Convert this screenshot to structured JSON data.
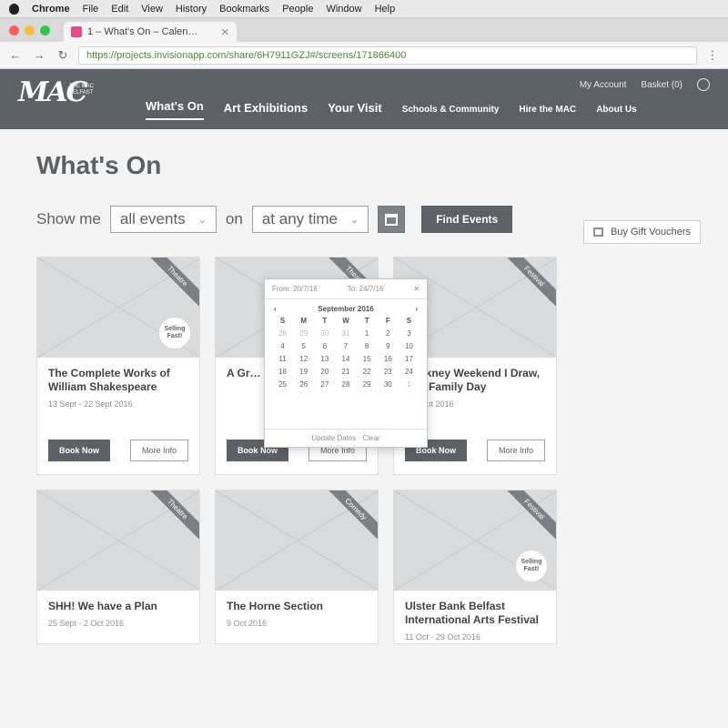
{
  "menubar": {
    "items": [
      "Chrome",
      "File",
      "Edit",
      "View",
      "History",
      "Bookmarks",
      "People",
      "Window",
      "Help"
    ]
  },
  "browser": {
    "tab_title": "1 – What's On – Calen…",
    "url": "https://projects.invisionapp.com/share/6H7911GZJ#/screens/171866400",
    "traffic_light_colors": [
      "#fc605b",
      "#fdbc40",
      "#34c84a"
    ]
  },
  "site": {
    "logo_mark": "MAC",
    "logo_sub": "THE MAC BELFAST",
    "util": {
      "account": "My Account",
      "basket": "Basket (0)"
    },
    "nav": [
      {
        "label": "What's On",
        "active": true,
        "size": "large"
      },
      {
        "label": "Art Exhibitions",
        "active": false,
        "size": "large"
      },
      {
        "label": "Your Visit",
        "active": false,
        "size": "large"
      },
      {
        "label": "Schools & Community",
        "active": false,
        "size": "small"
      },
      {
        "label": "Hire the MAC",
        "active": false,
        "size": "small"
      },
      {
        "label": "About Us",
        "active": false,
        "size": "small"
      }
    ]
  },
  "page": {
    "title": "What's On",
    "filter": {
      "show_me": "Show me",
      "event_type": "all events",
      "on": "on",
      "when": "at any time",
      "find_label": "Find Events"
    },
    "gift_voucher": "Buy Gift Vouchers"
  },
  "datepicker": {
    "from": "From: 20/7/16",
    "to": "To: 24/7/16",
    "month": "September 2016",
    "prev": "‹",
    "next": "›",
    "weekdays": [
      "S",
      "M",
      "T",
      "W",
      "T",
      "F",
      "S"
    ],
    "days": [
      "28",
      "29",
      "30",
      "31",
      "1",
      "2",
      "3",
      "4",
      "5",
      "6",
      "7",
      "8",
      "9",
      "10",
      "11",
      "12",
      "13",
      "14",
      "15",
      "16",
      "17",
      "18",
      "19",
      "20",
      "21",
      "22",
      "23",
      "24",
      "25",
      "26",
      "27",
      "28",
      "29",
      "30",
      "1"
    ],
    "footer": "Update Dates · Clear"
  },
  "cards": [
    {
      "title": "The Complete Works of William Shakespeare",
      "date": "13 Sept - 22 Sept 2016",
      "ribbon": "Theatre",
      "badge": "Selling Fast!",
      "book": "Book Now",
      "more": "More Info"
    },
    {
      "title": "A Gr…",
      "date": "",
      "ribbon": "Theatre",
      "badge": "",
      "book": "Book Now",
      "more": "More Info"
    },
    {
      "title": "Hockney Weekend I Draw, I Do Family Day",
      "date": "24 Sept 2016",
      "ribbon": "Festival",
      "badge": "",
      "book": "Book Now",
      "more": "More Info"
    },
    {
      "title": "SHH! We have a Plan",
      "date": "25 Sept - 2 Oct 2016",
      "ribbon": "Theatre",
      "badge": "",
      "book": "",
      "more": ""
    },
    {
      "title": "The Horne Section",
      "date": "9 Oct 2016",
      "ribbon": "Comedy",
      "badge": "",
      "book": "",
      "more": ""
    },
    {
      "title": "Ulster Bank Belfast International Arts Festival",
      "date": "11 Oct - 29 Oct 2016",
      "ribbon": "Festival",
      "badge": "Selling Fast!",
      "book": "",
      "more": ""
    }
  ]
}
